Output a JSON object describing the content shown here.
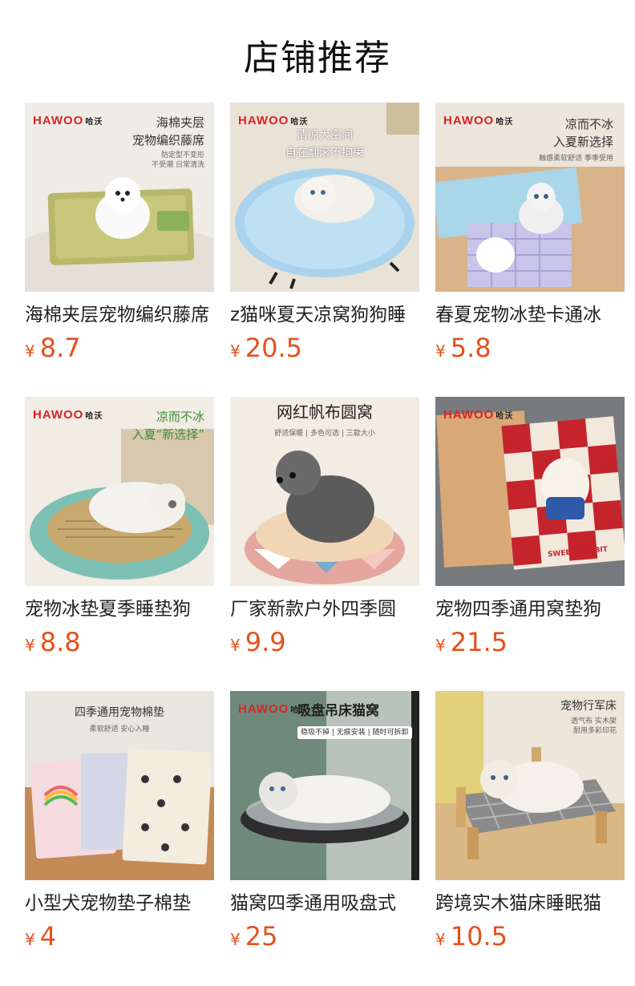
{
  "section": {
    "title": "店铺推荐"
  },
  "colors": {
    "price": "#e4511c",
    "brand": "#d8232a"
  },
  "products": [
    {
      "name": "海棉夹层宠物编织藤席",
      "currency": "¥",
      "price": "8.7",
      "image": {
        "brand": "HAWOO",
        "brand_cn": "哈沃",
        "headline": [
          "海棉夹层",
          "宠物编织藤席"
        ],
        "sub": [
          "防定型不变形",
          "不受潮 日常清洗"
        ]
      }
    },
    {
      "name": "z猫咪夏天凉窝狗狗睡",
      "currency": "¥",
      "price": "20.5",
      "image": {
        "brand": "HAWOO",
        "brand_cn": "哈沃",
        "headline": [
          "清凉大空间",
          "自在翻滚不拘束"
        ],
        "sub": []
      }
    },
    {
      "name": "春夏宠物冰垫卡通冰",
      "currency": "¥",
      "price": "5.8",
      "image": {
        "brand": "HAWOO",
        "brand_cn": "哈沃",
        "headline": [
          "凉而不冰",
          "入夏新选择"
        ],
        "sub": [
          "触感柔软舒适 季季受用"
        ]
      }
    },
    {
      "name": "宠物冰垫夏季睡垫狗",
      "currency": "¥",
      "price": "8.8",
      "image": {
        "brand": "HAWOO",
        "brand_cn": "哈沃",
        "headline": [
          "凉而不冰",
          "入夏“新选择”"
        ],
        "sub": []
      }
    },
    {
      "name": "厂家新款户外四季圆",
      "currency": "¥",
      "price": "9.9",
      "image": {
        "brand": "",
        "brand_cn": "",
        "headline": [
          "网红帆布圆窝"
        ],
        "sub": [
          "舒适保暖 | 多色可选 | 三款大小"
        ]
      }
    },
    {
      "name": "宠物四季通用窝垫狗",
      "currency": "¥",
      "price": "21.5",
      "image": {
        "brand": "HAWOO",
        "brand_cn": "哈沃",
        "headline": [],
        "sub": [
          "SWEET RABBIT"
        ]
      }
    },
    {
      "name": "小型犬宠物垫子棉垫",
      "currency": "¥",
      "price": "4",
      "image": {
        "brand": "",
        "brand_cn": "",
        "headline": [
          "四季通用宠物棉垫"
        ],
        "sub": [
          "柔软舒适 安心入睡"
        ]
      }
    },
    {
      "name": "猫窝四季通用吸盘式",
      "currency": "¥",
      "price": "25",
      "image": {
        "brand": "HAWOO",
        "brand_cn": "哈沃",
        "headline": [
          "吸盘吊床猫窝"
        ],
        "sub": [
          "稳吸不掉 | 无痕安装 | 随时可拆卸"
        ]
      }
    },
    {
      "name": "跨境实木猫床睡眠猫",
      "currency": "¥",
      "price": "10.5",
      "image": {
        "brand": "",
        "brand_cn": "",
        "headline": [
          "宠物行军床"
        ],
        "sub": [
          "透气布 实木架",
          "耐用多彩印花"
        ]
      }
    }
  ]
}
